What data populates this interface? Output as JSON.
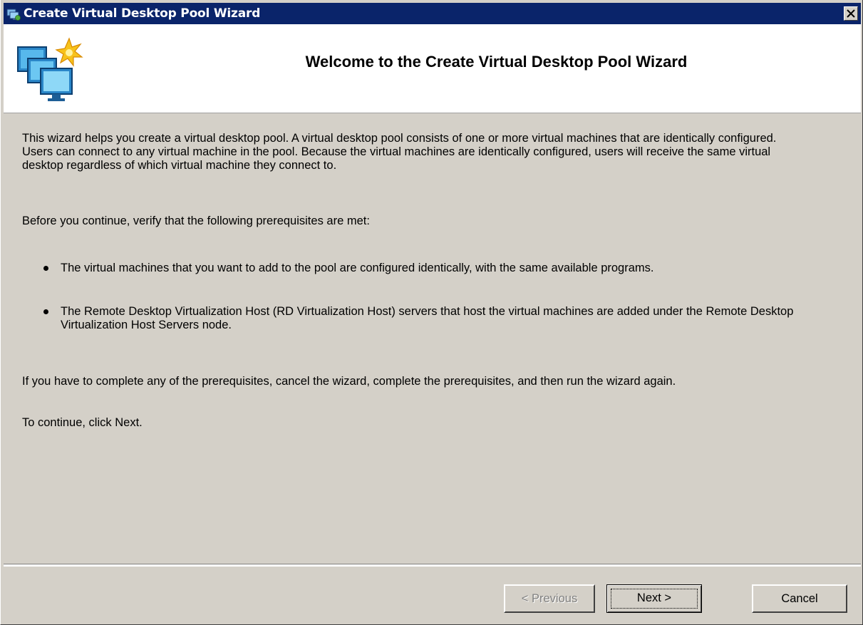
{
  "window": {
    "title": "Create Virtual Desktop Pool Wizard",
    "close_label": "×"
  },
  "header": {
    "title": "Welcome to the Create Virtual Desktop Pool Wizard",
    "icon": "virtual-desktops-icon"
  },
  "content": {
    "intro": "This wizard helps you create a virtual desktop pool.  A virtual desktop pool consists of one or more virtual machines that are identically configured.  Users can connect to any virtual machine in the pool.  Because the virtual machines are identically configured, users will receive the same virtual desktop regardless of which virtual machine they connect to.",
    "before": "Before you continue, verify that the following prerequisites are met:",
    "prerequisites": [
      "The virtual machines that you want to add to the pool are configured identically, with the same available programs.",
      "The Remote Desktop Virtualization Host (RD Virtualization Host) servers that host the virtual machines are added under the Remote Desktop Virtualization Host Servers node."
    ],
    "if_you_have": "If you have to complete any of the prerequisites, cancel the wizard, complete the prerequisites, and then run the wizard again.",
    "to_continue": "To continue, click Next."
  },
  "buttons": {
    "previous": "< Previous",
    "next": "Next >",
    "cancel": "Cancel",
    "previous_enabled": false
  },
  "colors": {
    "titlebar": "#0a246a",
    "dialog_bg": "#d4d0c8",
    "header_bg": "#ffffff"
  }
}
